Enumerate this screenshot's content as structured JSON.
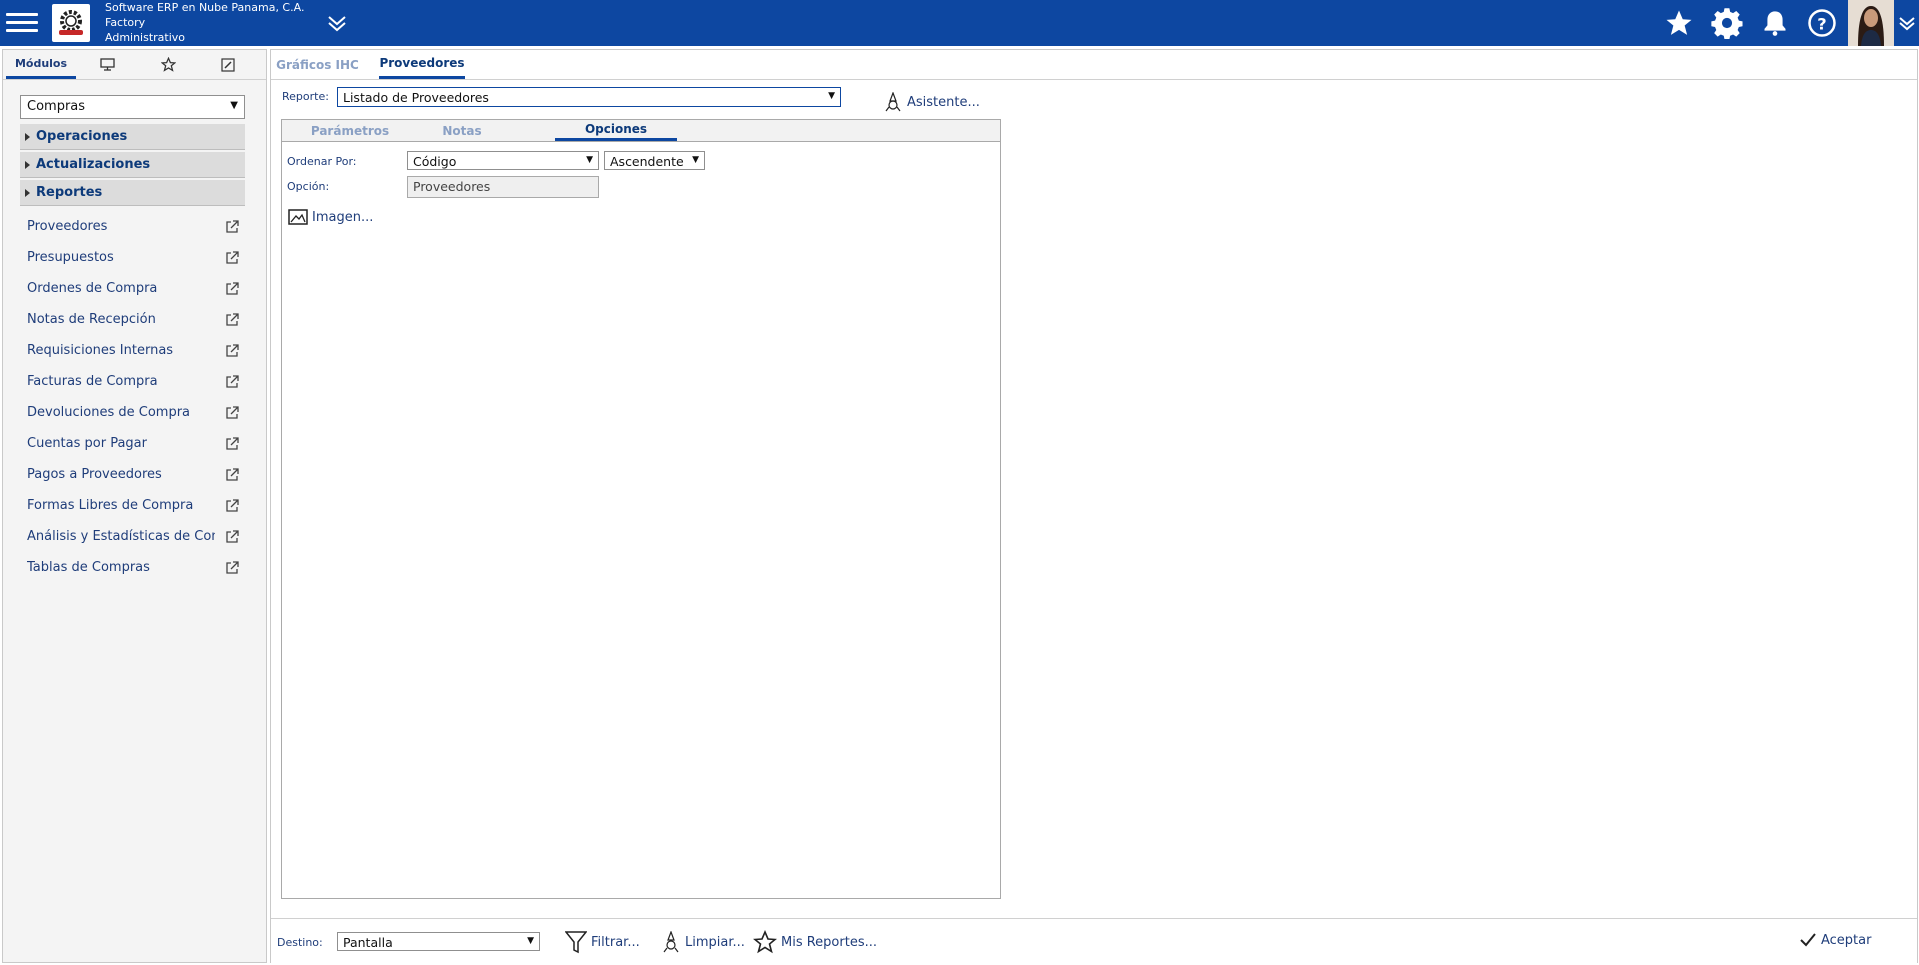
{
  "header": {
    "company_line1": "Software ERP en Nube Panama, C.A.",
    "company_line2": "Factory",
    "company_line3": "Administrativo",
    "icons": [
      "menu-icon",
      "logo-icon",
      "chevron-down-icon",
      "star-icon",
      "gear-icon",
      "bell-icon",
      "help-icon",
      "avatar",
      "chevron-down-icon"
    ]
  },
  "sidebar": {
    "tabs": [
      {
        "label": "Módulos",
        "icon": ""
      },
      {
        "label": "",
        "icon": "monitor-icon"
      },
      {
        "label": "",
        "icon": "star-icon"
      },
      {
        "label": "",
        "icon": "edit-icon"
      }
    ],
    "module_value": "Compras",
    "sections": [
      "Operaciones",
      "Actualizaciones",
      "Reportes"
    ],
    "items": [
      "Proveedores",
      "Presupuestos",
      "Órdenes de Compra",
      "Notas de Recepción",
      "Requisiciones Internas",
      "Facturas de Compra",
      "Devoluciones de Compra",
      "Cuentas por Pagar",
      "Pagos a Proveedores",
      "Formas Libres de Compra",
      "Análisis y Estadísticas de Con",
      "Tablas de Compras"
    ]
  },
  "main": {
    "tabs": [
      "Gráficos IHC",
      "Proveedores"
    ],
    "report_label": "Reporte:",
    "report_value": "Listado de Proveedores",
    "wizard_label": "Asistente...",
    "subtabs": [
      "Parámetros",
      "Notas",
      "Opciones"
    ],
    "order_label": "Ordenar Por:",
    "order_value": "Código",
    "order_dir": "Ascendente",
    "option_label": "Opción:",
    "option_value": "Proveedores",
    "image_label": "Imagen..."
  },
  "footer": {
    "dest_label": "Destino:",
    "dest_value": "Pantalla",
    "filter_label": "Filtrar...",
    "clear_label": "Limpiar...",
    "myreports_label": "Mis Reportes...",
    "accept_label": "Aceptar"
  },
  "colors": {
    "header_bg": "#0d47a1",
    "accent": "#0d47a1",
    "link": "#1f3d7a",
    "inactive_tab": "#8aa0c4"
  }
}
